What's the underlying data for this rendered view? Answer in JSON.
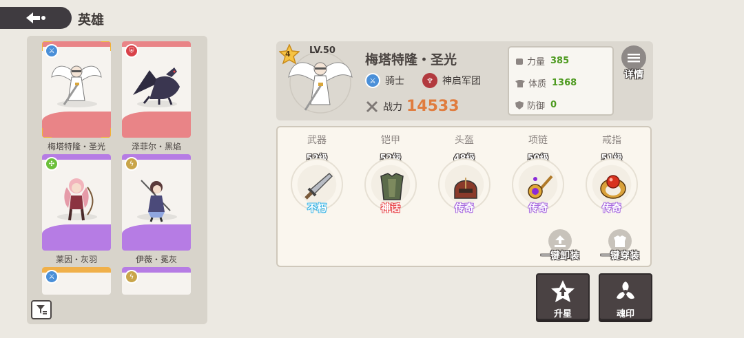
{
  "header": {
    "title": "英雄",
    "back_icon": "back-arrow-icon"
  },
  "hero_list": [
    {
      "name": "梅塔特隆・圣光",
      "class_icon": "sword-class-icon",
      "class_color": "#4a8fd8",
      "rarity_color": "#e98487",
      "selected": true
    },
    {
      "name": "泽菲尔・黑焰",
      "class_icon": "shield-class-icon",
      "class_color": "#d9424a",
      "rarity_color": "#e98487",
      "selected": false
    },
    {
      "name": "莱因・灰羽",
      "class_icon": "target-class-icon",
      "class_color": "#6bbf3a",
      "rarity_color": "#b67ce4",
      "selected": false
    },
    {
      "name": "伊薇・冕灰",
      "class_icon": "bolt-class-icon",
      "class_color": "#c9a54a",
      "rarity_color": "#b67ce4",
      "selected": false
    },
    {
      "name": "",
      "class_icon": "sword-class-icon",
      "class_color": "#4a8fd8",
      "rarity_color": "#f0b04a",
      "selected": false
    },
    {
      "name": "",
      "class_icon": "bolt-class-icon",
      "class_color": "#c9a54a",
      "rarity_color": "#b67ce4",
      "selected": false
    }
  ],
  "hero": {
    "stars": "4",
    "level": "LV.50",
    "name": "梅塔特隆・圣光",
    "class_name": "骑士",
    "faction": "神启军团",
    "power_label": "战力",
    "power": "14533"
  },
  "stats": [
    {
      "label": "力量",
      "value": "385",
      "icon": "fist-icon"
    },
    {
      "label": "体质",
      "value": "1368",
      "icon": "body-icon"
    },
    {
      "label": "防御",
      "value": "0",
      "icon": "shield-icon"
    }
  ],
  "detail_label": "详情",
  "equipment": [
    {
      "slot": "武器",
      "level": "52级",
      "rarity": "不朽",
      "rarity_color": "#38b4e6",
      "icon": "sword-icon"
    },
    {
      "slot": "铠甲",
      "level": "52级",
      "rarity": "神话",
      "rarity_color": "#e8454a",
      "icon": "armor-icon"
    },
    {
      "slot": "头盔",
      "level": "48级",
      "rarity": "传奇",
      "rarity_color": "#a86ae0",
      "icon": "helmet-icon"
    },
    {
      "slot": "项链",
      "level": "50级",
      "rarity": "传奇",
      "rarity_color": "#a86ae0",
      "icon": "necklace-icon"
    },
    {
      "slot": "戒指",
      "level": "51级",
      "rarity": "传奇",
      "rarity_color": "#a86ae0",
      "icon": "ring-icon"
    }
  ],
  "quick_actions": {
    "unequip_all": "一键卸装",
    "equip_all": "一键穿装"
  },
  "actions": {
    "star_up": "升星",
    "soul_mark": "魂印"
  }
}
